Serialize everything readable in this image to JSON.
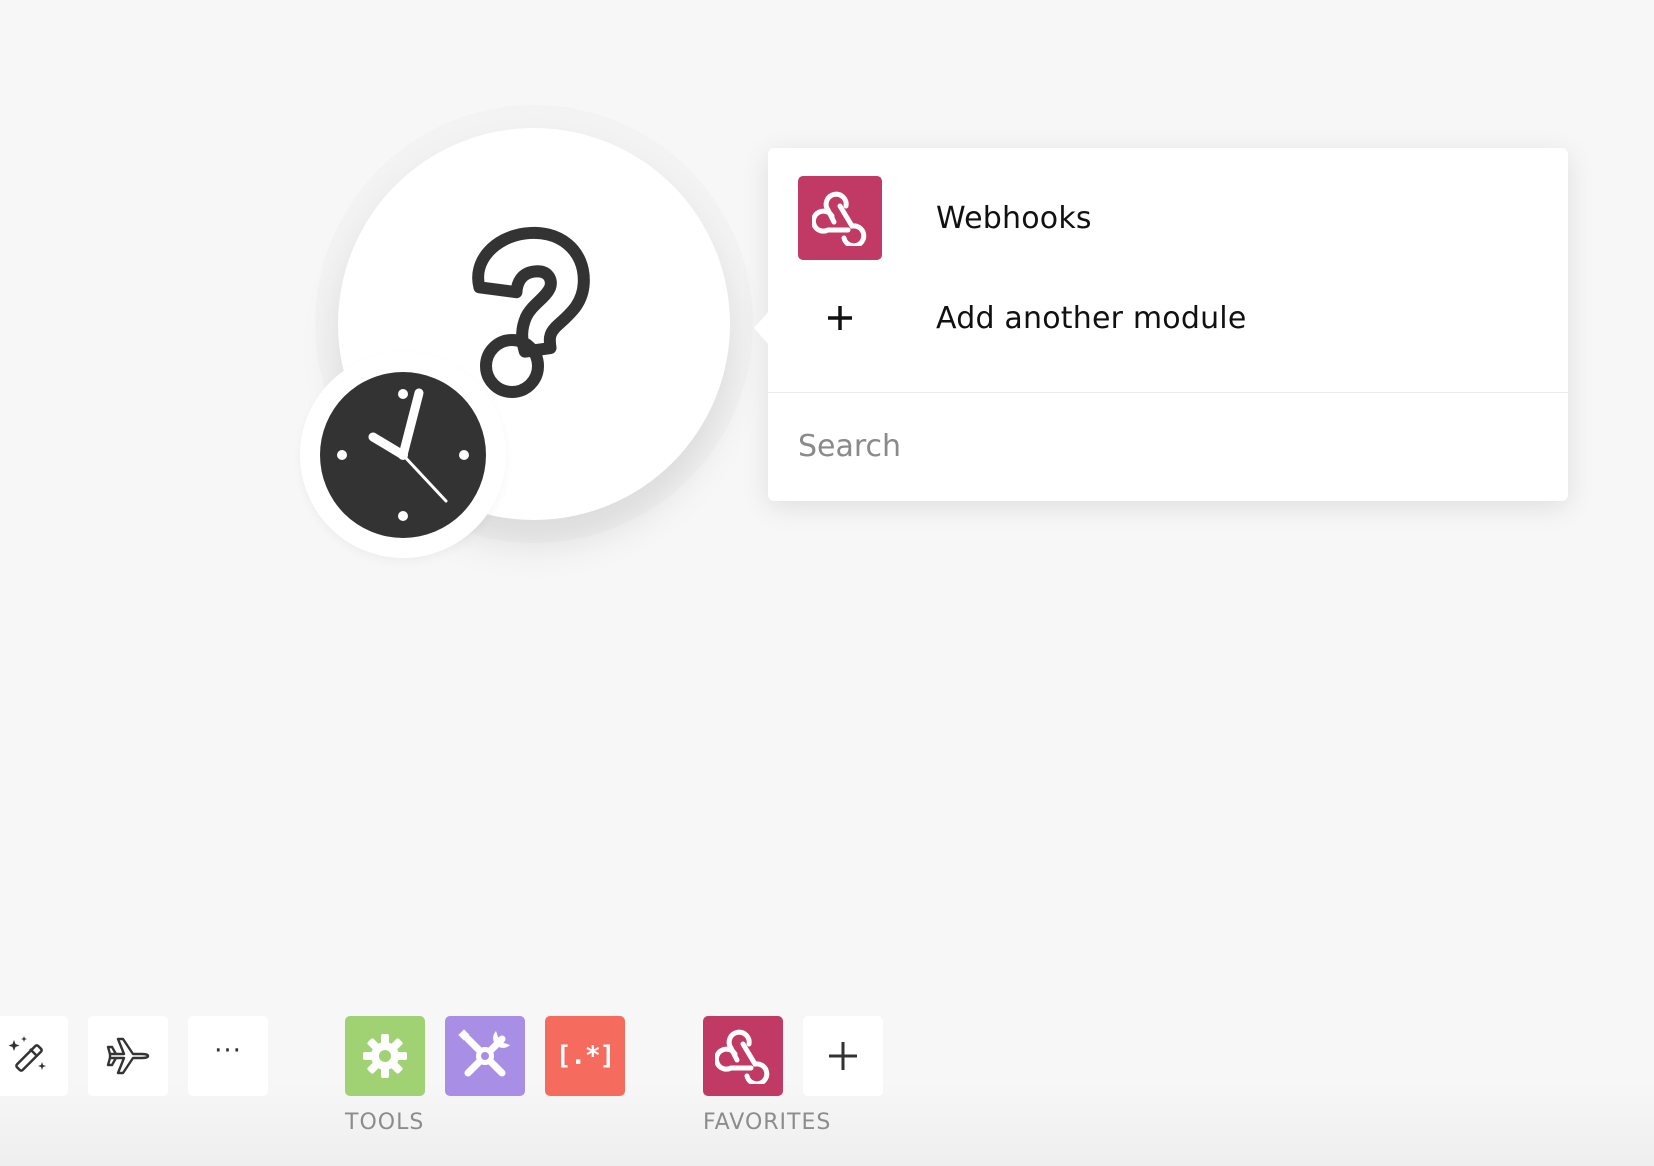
{
  "module": {
    "main_icon": "question-mark-icon",
    "trigger_badge_icon": "clock-icon"
  },
  "popover": {
    "items": [
      {
        "label": "Webhooks",
        "icon": "webhook-icon",
        "tile_color": "#c13a66"
      },
      {
        "label": "Add another module",
        "icon": "plus-icon"
      }
    ],
    "search": {
      "placeholder": "Search",
      "value": ""
    }
  },
  "toolbar": {
    "left_buttons": [
      {
        "icon": "magic-wand-icon"
      },
      {
        "icon": "airplane-icon"
      },
      {
        "icon": "more-icon",
        "text": "···"
      }
    ],
    "tools": {
      "label": "TOOLS",
      "buttons": [
        {
          "icon": "gear-icon",
          "color": "#a0d274"
        },
        {
          "icon": "tools-icon",
          "color": "#a98ee6"
        },
        {
          "icon": "regex-icon",
          "text": "[.*]",
          "color": "#f56b5e"
        }
      ]
    },
    "favorites": {
      "label": "FAVORITES",
      "buttons": [
        {
          "icon": "webhook-icon",
          "color": "#c13a66"
        },
        {
          "icon": "plus-icon"
        }
      ]
    }
  },
  "colors": {
    "background": "#f7f7f7",
    "icon_dark": "#333333"
  }
}
